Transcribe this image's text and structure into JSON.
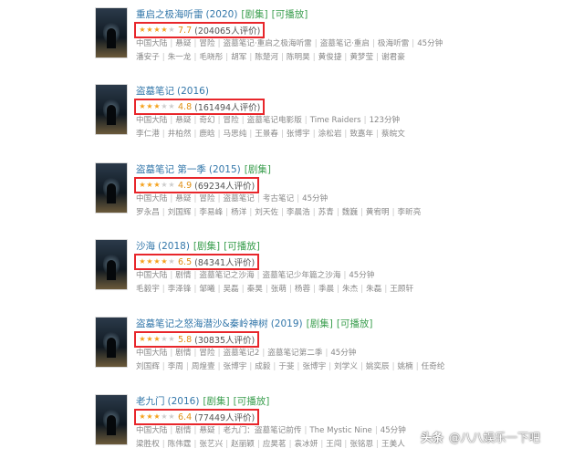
{
  "colors": {
    "title": "#3377aa",
    "tag": "#3a9e4e",
    "star_on": "#f4a11b",
    "star_off": "#cccccc",
    "highlight_box": "#e8262b"
  },
  "items": [
    {
      "title": "重启之极海听雷",
      "year": "(2020)",
      "tags": [
        "[剧集]",
        "[可播放]"
      ],
      "stars": 4,
      "score": "7.7",
      "count": "(204065人评价)",
      "meta": [
        "中国大陆",
        "悬疑",
        "冒险",
        "盗墓笔记·重启之极海听雷",
        "盗墓笔记·重启",
        "极海听雷",
        "45分钟"
      ],
      "cast": [
        "潘安子",
        "朱一龙",
        "毛晓彤",
        "胡军",
        "陈楚河",
        "陈明昊",
        "黄俊捷",
        "黄梦莹",
        "谢君豪"
      ]
    },
    {
      "title": "盗墓笔记",
      "year": "(2016)",
      "tags": [],
      "stars": 2.5,
      "score": "4.8",
      "count": "(161494人评价)",
      "meta": [
        "中国大陆",
        "悬疑",
        "奇幻",
        "冒险",
        "盗墓笔记电影版",
        "Time Raiders",
        "123分钟"
      ],
      "cast": [
        "李仁港",
        "井柏然",
        "鹿晗",
        "马思纯",
        "王景春",
        "张博宇",
        "涂松岩",
        "致嘉年",
        "蔡皖文"
      ]
    },
    {
      "title": "盗墓笔记 第一季",
      "year": "(2015)",
      "tags": [
        "[剧集]"
      ],
      "stars": 2.5,
      "score": "4.9",
      "count": "(69234人评价)",
      "meta": [
        "中国大陆",
        "悬疑",
        "冒险",
        "盗墓笔记",
        "考古笔记",
        "45分钟"
      ],
      "cast": [
        "罗永昌",
        "刘国辉",
        "李易峰",
        "杨洋",
        "刘天佐",
        "李晨浩",
        "苏青",
        "魏巍",
        "黄宥明",
        "李昕亮"
      ]
    },
    {
      "title": "沙海",
      "year": "(2018)",
      "tags": [
        "[剧集]",
        "[可播放]"
      ],
      "stars": 3.5,
      "score": "6.5",
      "count": "(84341人评价)",
      "meta": [
        "中国大陆",
        "剧情",
        "盗墓笔记之沙海",
        "盗墓笔记少年篇之沙海",
        "45分钟"
      ],
      "cast": [
        "毛毅宇",
        "李泽锋",
        "邹曦",
        "吴磊",
        "秦昊",
        "张萌",
        "杨蓉",
        "季晨",
        "朱杰",
        "朱磊",
        "王顾轩"
      ]
    },
    {
      "title": "盗墓笔记之怒海潜沙&秦岭神树",
      "year": "(2019)",
      "tags": [
        "[剧集]",
        "[可播放]"
      ],
      "stars": 3,
      "score": "5.8",
      "count": "(30835人评价)",
      "meta": [
        "中国大陆",
        "剧情",
        "冒险",
        "盗墓笔记2",
        "盗墓笔记第二季",
        "45分钟"
      ],
      "cast": [
        "刘国辉",
        "李周",
        "周煌壹",
        "张博宇",
        "成毅",
        "于斐",
        "张博宇",
        "刘学义",
        "姚奕辰",
        "姚楠",
        "任奇纶"
      ]
    },
    {
      "title": "老九门",
      "year": "(2016)",
      "tags": [
        "[剧集]",
        "[可播放]"
      ],
      "stars": 3,
      "score": "6.4",
      "count": "(77449人评价)",
      "meta": [
        "中国大陆",
        "剧情",
        "悬疑",
        "老九门：盗墓笔记前传",
        "The Mystic Nine",
        "45分钟"
      ],
      "cast": [
        "梁胜权",
        "陈伟霆",
        "张艺兴",
        "赵丽颖",
        "应昊茗",
        "袁冰妍",
        "王闯",
        "张铭恩",
        "王美人"
      ]
    }
  ],
  "watermark": {
    "logo": "头条",
    "text": "@八八娱乐一下吧"
  }
}
